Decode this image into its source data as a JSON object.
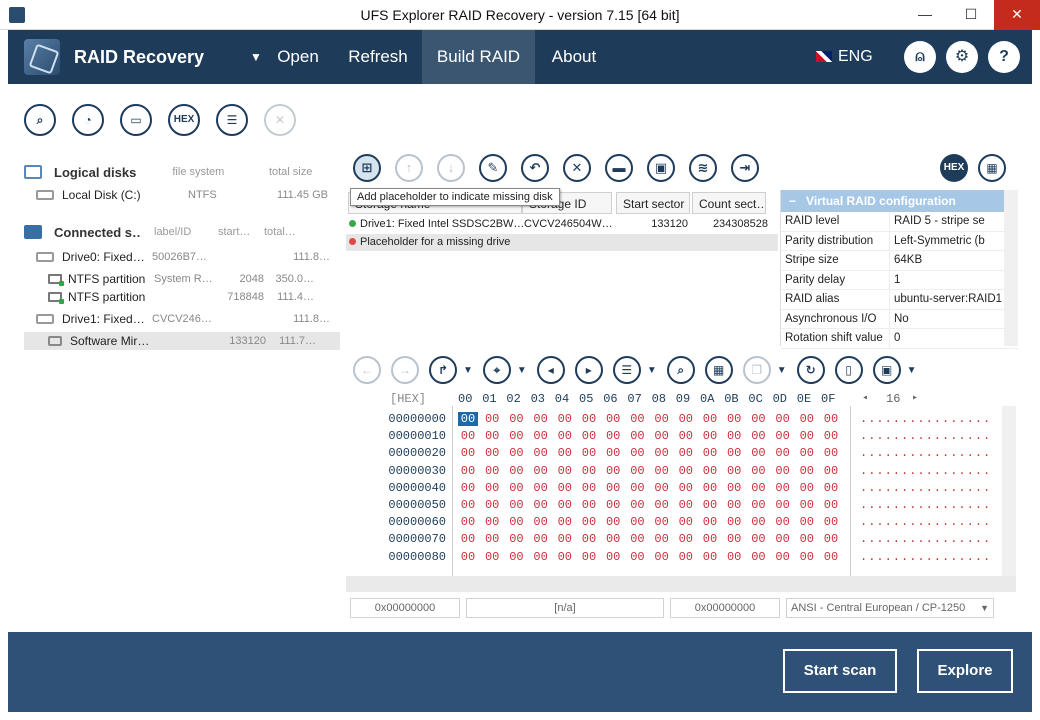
{
  "window": {
    "title": "UFS Explorer RAID Recovery - version 7.15 [64 bit]"
  },
  "nav": {
    "brand": "RAID Recovery",
    "dropdown_arrow": "▼",
    "items": [
      "Open",
      "Refresh",
      "Build RAID",
      "About"
    ],
    "active": "Build RAID",
    "language": "ENG",
    "icons": [
      "user-icon",
      "gear-icon",
      "help-icon"
    ]
  },
  "toolbar": {
    "icons": [
      "search-icon",
      "scan-icon",
      "disk-icon",
      "hex-icon",
      "list-icon",
      "close-icon"
    ],
    "hex_label": "HEX"
  },
  "left": {
    "logical": {
      "title": "Logical disks",
      "col1": "file system",
      "col2": "total size",
      "rows": [
        {
          "name": "Local Disk (C:)",
          "fs": "NTFS",
          "size": "111.45 GB"
        }
      ]
    },
    "connected": {
      "title": "Connected s…",
      "col1": "label/ID",
      "col2": "start…",
      "col3": "total…",
      "rows": [
        {
          "name": "Drive0: Fixed…",
          "id": "50026B7…",
          "start": "",
          "total": "111.8…",
          "type": "disk"
        },
        {
          "name": "NTFS partition",
          "id": "System R…",
          "start": "2048",
          "total": "350.0…",
          "type": "part"
        },
        {
          "name": "NTFS partition",
          "id": "",
          "start": "718848",
          "total": "111.4…",
          "type": "part"
        },
        {
          "name": "Drive1: Fixed…",
          "id": "CVCV246…",
          "start": "",
          "total": "111.8…",
          "type": "disk"
        },
        {
          "name": "Software Mir…",
          "id": "",
          "start": "133120",
          "total": "111.7…",
          "type": "raid"
        }
      ]
    }
  },
  "raid": {
    "tooltip": "Add placeholder to indicate missing disk",
    "headers": [
      "Storage name",
      "Storage ID",
      "Start sector",
      "Count sect…"
    ],
    "rows": [
      {
        "name": "Drive1: Fixed Intel SSDSC2BW…",
        "id": "CVCV246504W…",
        "start": "133120",
        "count": "234308528",
        "status": "#3aa84a"
      },
      {
        "name": "Placeholder for a missing drive",
        "id": "",
        "start": "",
        "count": "",
        "status": "#e04848"
      }
    ],
    "hex_label": "HEX"
  },
  "vcfg": {
    "title": "Virtual RAID configuration",
    "collapse": "−",
    "rows": [
      {
        "k": "RAID level",
        "v": "RAID 5 - stripe se",
        "dd": true
      },
      {
        "k": "Parity distribution",
        "v": "Left-Symmetric (b",
        "dd": true
      },
      {
        "k": "Stripe size",
        "v": "64KB",
        "dd": true
      },
      {
        "k": "Parity delay",
        "v": "1",
        "dd": false
      },
      {
        "k": "RAID alias",
        "v": "ubuntu-server:RAID1",
        "dd": false
      },
      {
        "k": "Asynchronous I/O",
        "v": "No",
        "dd": true
      },
      {
        "k": "Rotation shift value",
        "v": "0",
        "dd": false
      }
    ]
  },
  "hex": {
    "label": "[HEX]",
    "cols": [
      "00",
      "01",
      "02",
      "03",
      "04",
      "05",
      "06",
      "07",
      "08",
      "09",
      "0A",
      "0B",
      "0C",
      "0D",
      "0E",
      "0F"
    ],
    "width": "16",
    "offsets": [
      "00000000",
      "00000010",
      "00000020",
      "00000030",
      "00000040",
      "00000050",
      "00000060",
      "00000070",
      "00000080"
    ],
    "byte": "00",
    "ascii": "................"
  },
  "status": {
    "offset1": "0x00000000",
    "value": "[n/a]",
    "offset2": "0x00000000",
    "encoding": "ANSI - Central European / CP-1250"
  },
  "footer": {
    "start_scan": "Start scan",
    "explore": "Explore"
  }
}
